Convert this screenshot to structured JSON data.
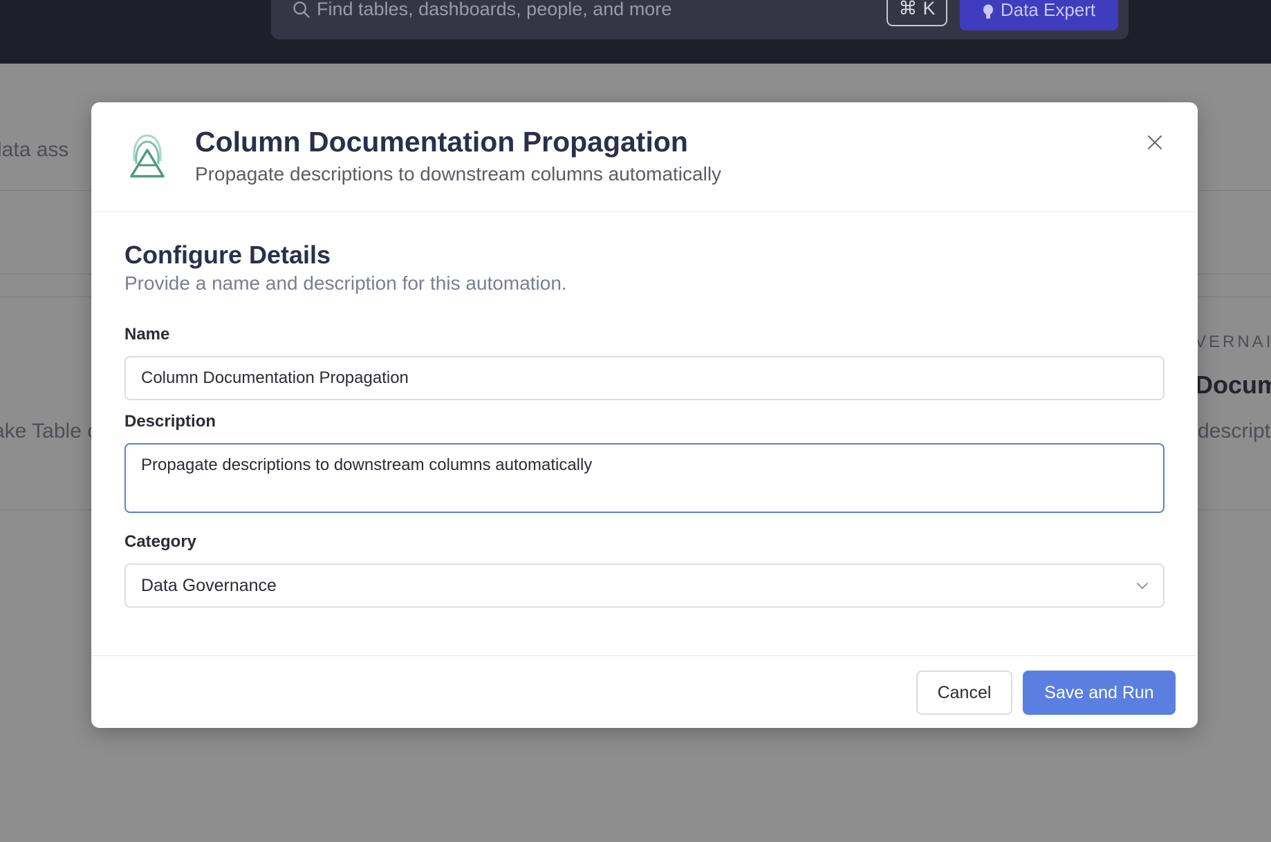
{
  "topbar": {
    "search_placeholder": "Find tables, dashboards, people, and more",
    "shortcut_symbol": "⌘",
    "shortcut_key": "K",
    "data_expert_label": "Data Expert"
  },
  "background": {
    "fragment_1": "data ass",
    "fragment_2": "ake Table c",
    "fragment_3": "VERNAI",
    "fragment_4": "Docum",
    "fragment_5": "descripti"
  },
  "modal": {
    "title": "Column Documentation Propagation",
    "subtitle": "Propagate descriptions to downstream columns automatically",
    "section_title": "Configure Details",
    "section_subtitle": "Provide a name and description for this automation.",
    "name_label": "Name",
    "name_value": "Column Documentation Propagation",
    "description_label": "Description",
    "description_value": "Propagate descriptions to downstream columns automatically",
    "category_label": "Category",
    "category_value": "Data Governance",
    "cancel_label": "Cancel",
    "save_label": "Save and Run"
  },
  "colors": {
    "primary": "#5a7fe0",
    "topbar_bg": "#1e1f2b",
    "data_expert_bg": "#3f3dbd",
    "logo": "#5ea88a"
  }
}
